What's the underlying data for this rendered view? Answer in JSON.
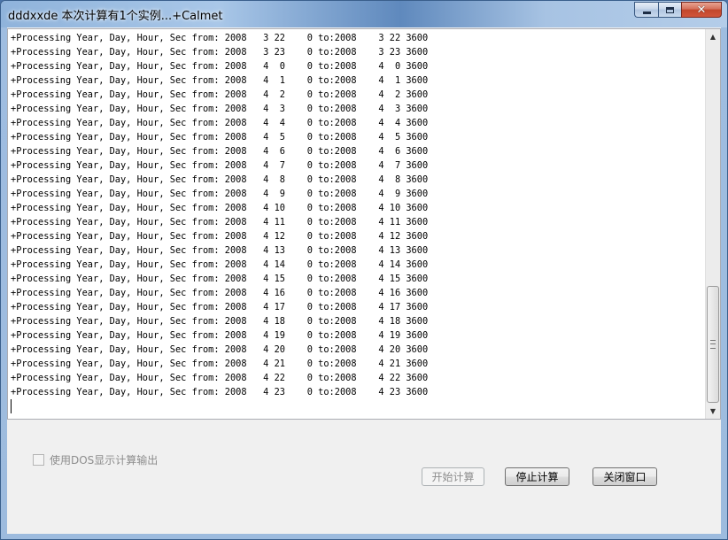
{
  "window": {
    "title": "dddxxde  本次计算有1个实例...+Calmet",
    "minimize_icon": "minimize-icon",
    "maximize_icon": "maximize-icon",
    "close_icon": "close-icon",
    "close_glyph": "✕"
  },
  "log": {
    "lines": [
      "+Processing Year, Day, Hour, Sec from: 2008   3 22    0 to:2008    3 22 3600",
      "+Processing Year, Day, Hour, Sec from: 2008   3 23    0 to:2008    3 23 3600",
      "+Processing Year, Day, Hour, Sec from: 2008   4  0    0 to:2008    4  0 3600",
      "+Processing Year, Day, Hour, Sec from: 2008   4  1    0 to:2008    4  1 3600",
      "+Processing Year, Day, Hour, Sec from: 2008   4  2    0 to:2008    4  2 3600",
      "+Processing Year, Day, Hour, Sec from: 2008   4  3    0 to:2008    4  3 3600",
      "+Processing Year, Day, Hour, Sec from: 2008   4  4    0 to:2008    4  4 3600",
      "+Processing Year, Day, Hour, Sec from: 2008   4  5    0 to:2008    4  5 3600",
      "+Processing Year, Day, Hour, Sec from: 2008   4  6    0 to:2008    4  6 3600",
      "+Processing Year, Day, Hour, Sec from: 2008   4  7    0 to:2008    4  7 3600",
      "+Processing Year, Day, Hour, Sec from: 2008   4  8    0 to:2008    4  8 3600",
      "+Processing Year, Day, Hour, Sec from: 2008   4  9    0 to:2008    4  9 3600",
      "+Processing Year, Day, Hour, Sec from: 2008   4 10    0 to:2008    4 10 3600",
      "+Processing Year, Day, Hour, Sec from: 2008   4 11    0 to:2008    4 11 3600",
      "+Processing Year, Day, Hour, Sec from: 2008   4 12    0 to:2008    4 12 3600",
      "+Processing Year, Day, Hour, Sec from: 2008   4 13    0 to:2008    4 13 3600",
      "+Processing Year, Day, Hour, Sec from: 2008   4 14    0 to:2008    4 14 3600",
      "+Processing Year, Day, Hour, Sec from: 2008   4 15    0 to:2008    4 15 3600",
      "+Processing Year, Day, Hour, Sec from: 2008   4 16    0 to:2008    4 16 3600",
      "+Processing Year, Day, Hour, Sec from: 2008   4 17    0 to:2008    4 17 3600",
      "+Processing Year, Day, Hour, Sec from: 2008   4 18    0 to:2008    4 18 3600",
      "+Processing Year, Day, Hour, Sec from: 2008   4 19    0 to:2008    4 19 3600",
      "+Processing Year, Day, Hour, Sec from: 2008   4 20    0 to:2008    4 20 3600",
      "+Processing Year, Day, Hour, Sec from: 2008   4 21    0 to:2008    4 21 3600",
      "+Processing Year, Day, Hour, Sec from: 2008   4 22    0 to:2008    4 22 3600",
      "+Processing Year, Day, Hour, Sec from: 2008   4 23    0 to:2008    4 23 3600"
    ],
    "scroll_up_glyph": "▲",
    "scroll_down_glyph": "▼"
  },
  "options": {
    "dos_output_label": "使用DOS显示计算输出",
    "dos_output_checked": false
  },
  "buttons": {
    "start_label": "开始计算",
    "start_enabled": false,
    "stop_label": "停止计算",
    "close_label": "关闭窗口"
  },
  "colors": {
    "title_bar": "#a9c7e8",
    "close_button": "#c2462b",
    "disabled_text": "#8d8d8d"
  }
}
